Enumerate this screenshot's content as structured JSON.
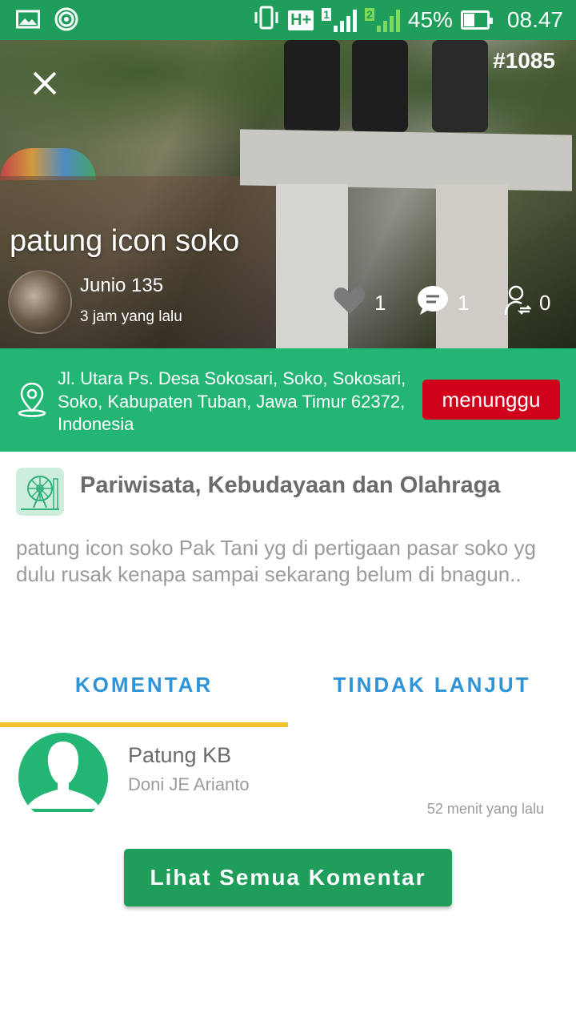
{
  "status_bar": {
    "battery": "45%",
    "time": "08.47",
    "network": "H+",
    "sim1": "1",
    "sim2": "2",
    "icons": [
      "image-icon",
      "hotspot-icon",
      "vibrate-icon",
      "signal-icon",
      "battery-icon"
    ]
  },
  "report": {
    "id": "#1085",
    "title": "patung icon soko",
    "author": "Junio 135",
    "posted": "3 jam yang lalu",
    "likes": "1",
    "comments": "1",
    "follows": "0"
  },
  "location": {
    "address": "Jl. Utara Ps. Desa Sokosari, Soko, Sokosari, Soko, Kabupaten Tuban, Jawa Timur 62372, Indonesia",
    "status_label": "menunggu"
  },
  "category": {
    "name": "Pariwisata, Kebudayaan dan Olahraga",
    "icon": "ferris-wheel-icon"
  },
  "description": "patung icon soko Pak Tani yg di pertigaan pasar soko yg dulu rusak kenapa sampai sekarang belum di bnagun..",
  "tabs": {
    "komentar": "KOMENTAR",
    "tindak_lanjut": "TINDAK LANJUT",
    "active": "komentar"
  },
  "comment": {
    "title": "Patung KB",
    "author": "Doni JE Arianto",
    "time": "52 menit yang lalu"
  },
  "all_comments_label": "Lihat Semua Komentar",
  "colors": {
    "primary_green": "#1f9e5b",
    "location_green": "#22b573",
    "status_red": "#d0021b",
    "tab_blue": "#2f93d8",
    "tab_indicator": "#f2c12e"
  }
}
